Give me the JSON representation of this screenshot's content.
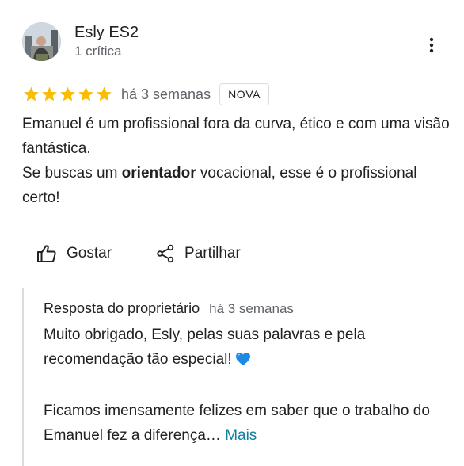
{
  "review": {
    "author_name": "Esly ES2",
    "author_meta": "1 crítica",
    "stars": 5,
    "date": "há 3 semanas",
    "badge": "NOVA",
    "text_line1": "Emanuel é um profissional fora da curva, ético e com uma visão fantástica.",
    "text_part2_before": "Se buscas um ",
    "text_part2_bold": "orientador",
    "text_part2_after": " vocacional, esse é o profissional certo!"
  },
  "actions": {
    "like_label": "Gostar",
    "share_label": "Partilhar"
  },
  "reply": {
    "title": "Resposta do proprietário",
    "date": "há 3 semanas",
    "paragraph1": "Muito obrigado, Esly, pelas suas palavras e pela recomendação tão especial!",
    "paragraph2": "Ficamos imensamente felizes em saber que o trabalho do Emanuel fez a diferença…",
    "more_label": "Mais"
  },
  "icons": {
    "more": "more-vert-icon",
    "star": "star-icon",
    "like": "thumb-up-icon",
    "share": "share-icon",
    "heart": "blue-heart-icon"
  },
  "colors": {
    "star": "#fbbc04",
    "link": "#137fa0",
    "heart": "#1e88e5"
  }
}
